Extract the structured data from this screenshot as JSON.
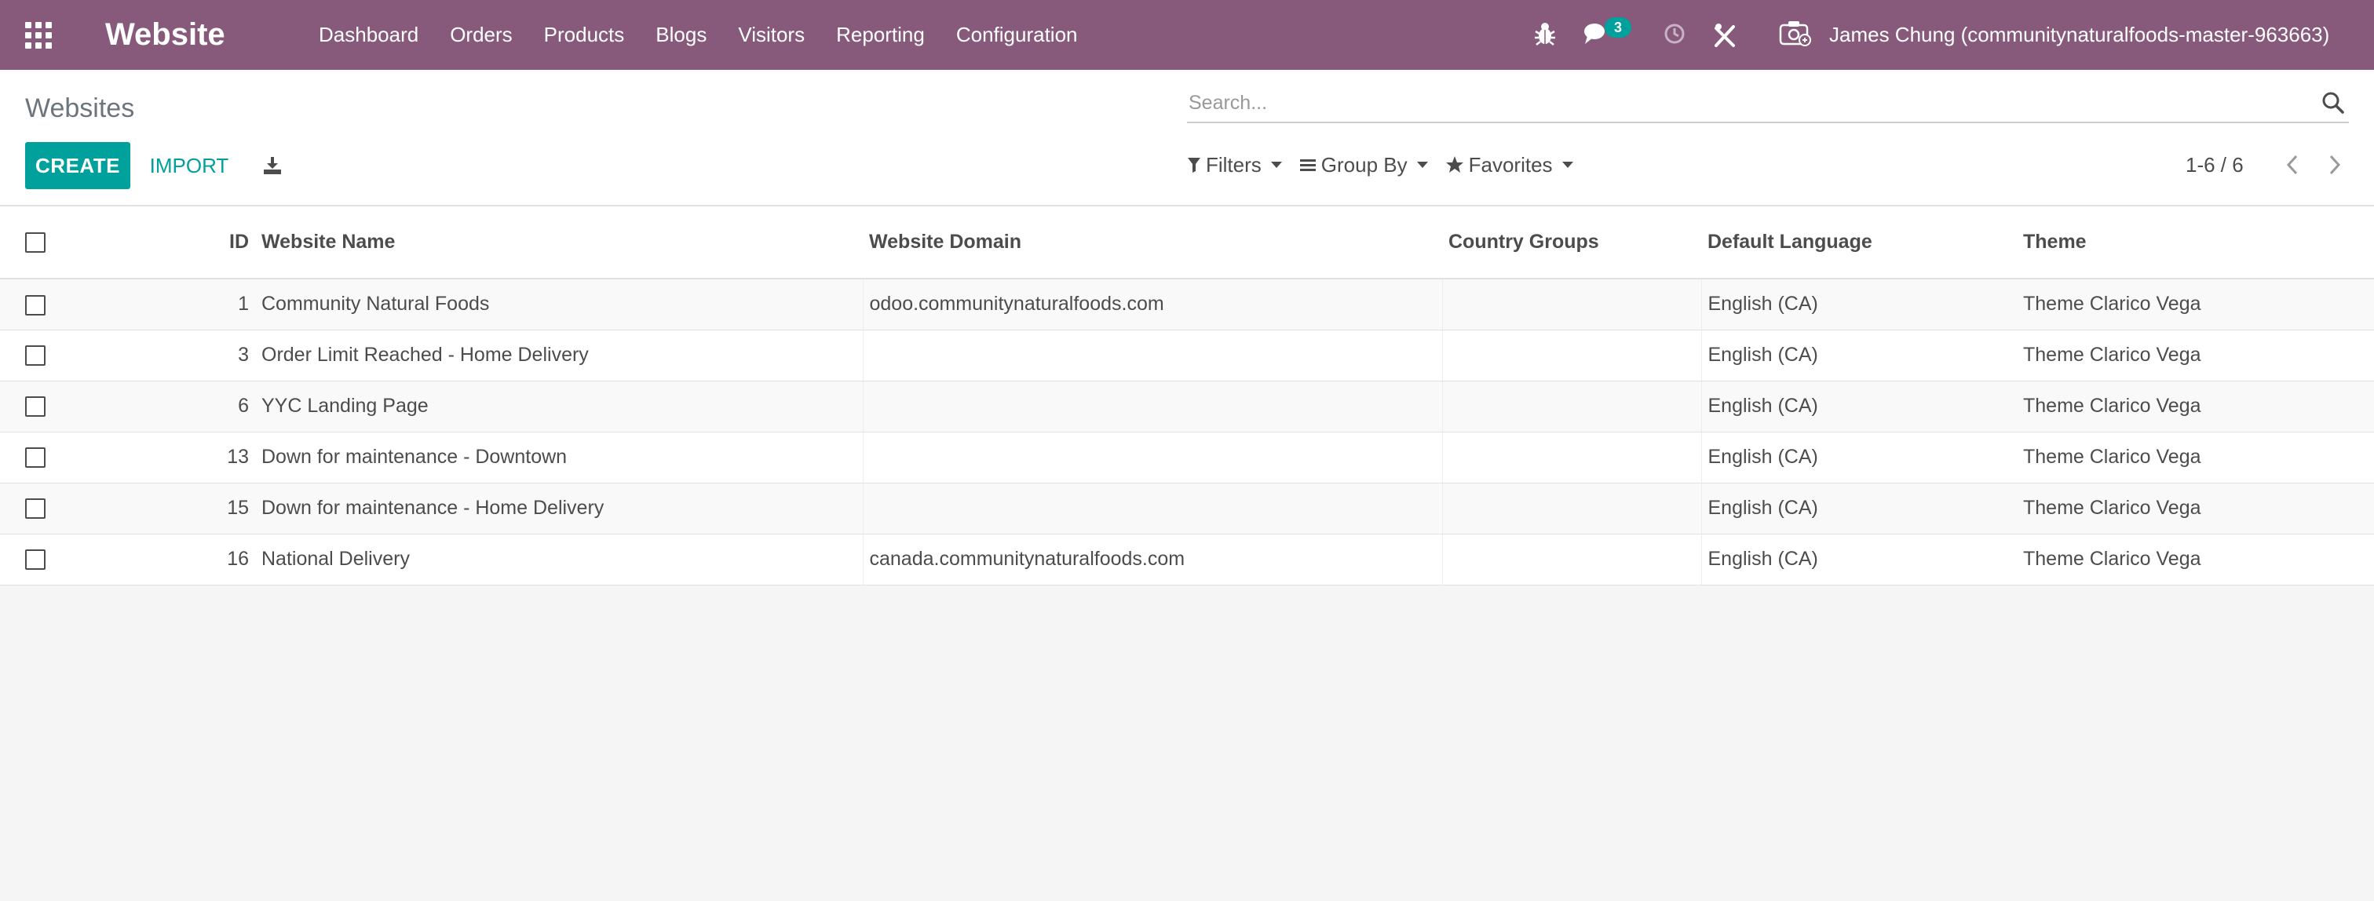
{
  "navbar": {
    "app_name": "Website",
    "menu": [
      "Dashboard",
      "Orders",
      "Products",
      "Blogs",
      "Visitors",
      "Reporting",
      "Configuration"
    ],
    "message_count": "3",
    "user": "James Chung (communitynaturalfoods-master-963663)",
    "bg_color": "#875a7b"
  },
  "control_panel": {
    "breadcrumb": "Websites",
    "search_placeholder": "Search...",
    "create_label": "CREATE",
    "import_label": "IMPORT",
    "filters_label": "Filters",
    "groupby_label": "Group By",
    "favorites_label": "Favorites",
    "pager": "1-6 / 6",
    "accent_color": "#00a09d"
  },
  "table": {
    "columns": [
      "ID",
      "Website Name",
      "Website Domain",
      "Country Groups",
      "Default Language",
      "Theme"
    ],
    "rows": [
      {
        "id": "1",
        "name": "Community Natural Foods",
        "domain": "odoo.communitynaturalfoods.com",
        "country_groups": "",
        "language": "English (CA)",
        "theme": "Theme Clarico Vega"
      },
      {
        "id": "3",
        "name": "Order Limit Reached - Home Delivery",
        "domain": "",
        "country_groups": "",
        "language": "English (CA)",
        "theme": "Theme Clarico Vega"
      },
      {
        "id": "6",
        "name": "YYC Landing Page",
        "domain": "",
        "country_groups": "",
        "language": "English (CA)",
        "theme": "Theme Clarico Vega"
      },
      {
        "id": "13",
        "name": "Down for maintenance - Downtown",
        "domain": "",
        "country_groups": "",
        "language": "English (CA)",
        "theme": "Theme Clarico Vega"
      },
      {
        "id": "15",
        "name": "Down for maintenance - Home Delivery",
        "domain": "",
        "country_groups": "",
        "language": "English (CA)",
        "theme": "Theme Clarico Vega"
      },
      {
        "id": "16",
        "name": "National Delivery",
        "domain": "canada.communitynaturalfoods.com",
        "country_groups": "",
        "language": "English (CA)",
        "theme": "Theme Clarico Vega"
      }
    ]
  }
}
